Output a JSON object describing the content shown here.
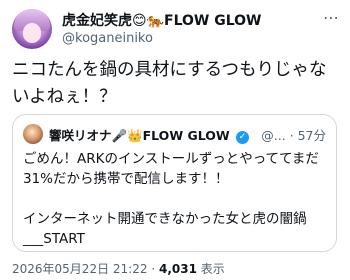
{
  "author": {
    "display_name": "虎金妃笑虎😊🐅FLOW GLOW",
    "handle": "@koganeiniko"
  },
  "menu_icon": "more-dots-icon",
  "tweet": {
    "text": "ニコたんを鍋の具材にするつもりじゃないよねぇ！？"
  },
  "quoted": {
    "display_name": "響咲リオナ🎤👑FLOW GLOW",
    "verified_icon": "verified-badge-icon",
    "meta": "@... · 57分",
    "text": "ごめん！ARKのインストールずっとやっててまだ31%だから携帯で配信します！！\n\nインターネット開通できなかった女と虎の闇鍋___START"
  },
  "footer": {
    "timestamp": "2026年05月22日 21:22",
    "separator": "·",
    "views_count": "4,031",
    "views_label": "表示"
  },
  "colors": {
    "text": "#0f1419",
    "secondary": "#536471",
    "border": "#cfd9de",
    "verified": "#1d9bf0"
  }
}
